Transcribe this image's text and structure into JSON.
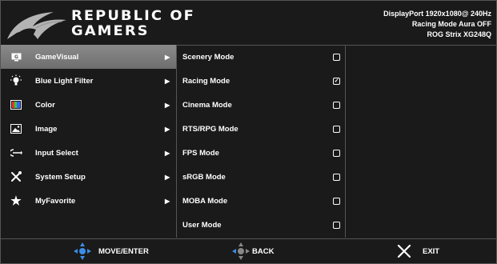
{
  "brand": {
    "line1": "REPUBLIC OF",
    "line2": "GAMERS"
  },
  "info": [
    "DisplayPort  1920x1080@ 240Hz",
    "Racing Mode Aura OFF",
    "ROG Strix XG248Q"
  ],
  "menu": [
    {
      "label": "GameVisual",
      "icon": "gamevisual-icon",
      "selected": true
    },
    {
      "label": "Blue Light Filter",
      "icon": "bulb-icon"
    },
    {
      "label": "Color",
      "icon": "color-icon"
    },
    {
      "label": "Image",
      "icon": "image-icon"
    },
    {
      "label": "Input Select",
      "icon": "input-select-icon"
    },
    {
      "label": "System Setup",
      "icon": "tools-icon"
    },
    {
      "label": "MyFavorite",
      "icon": "star-icon"
    }
  ],
  "modes": [
    {
      "label": "Scenery Mode",
      "checked": false
    },
    {
      "label": "Racing Mode",
      "checked": true
    },
    {
      "label": "Cinema Mode",
      "checked": false
    },
    {
      "label": "RTS/RPG Mode",
      "checked": false
    },
    {
      "label": "FPS Mode",
      "checked": false
    },
    {
      "label": "sRGB Mode",
      "checked": false
    },
    {
      "label": "MOBA Mode",
      "checked": false
    },
    {
      "label": "User Mode",
      "checked": false
    }
  ],
  "footer": {
    "move": "MOVE/ENTER",
    "back": "BACK",
    "exit": "EXIT"
  },
  "colors": {
    "accent": "#3a8ee6",
    "selected": "#7c7c7c"
  }
}
